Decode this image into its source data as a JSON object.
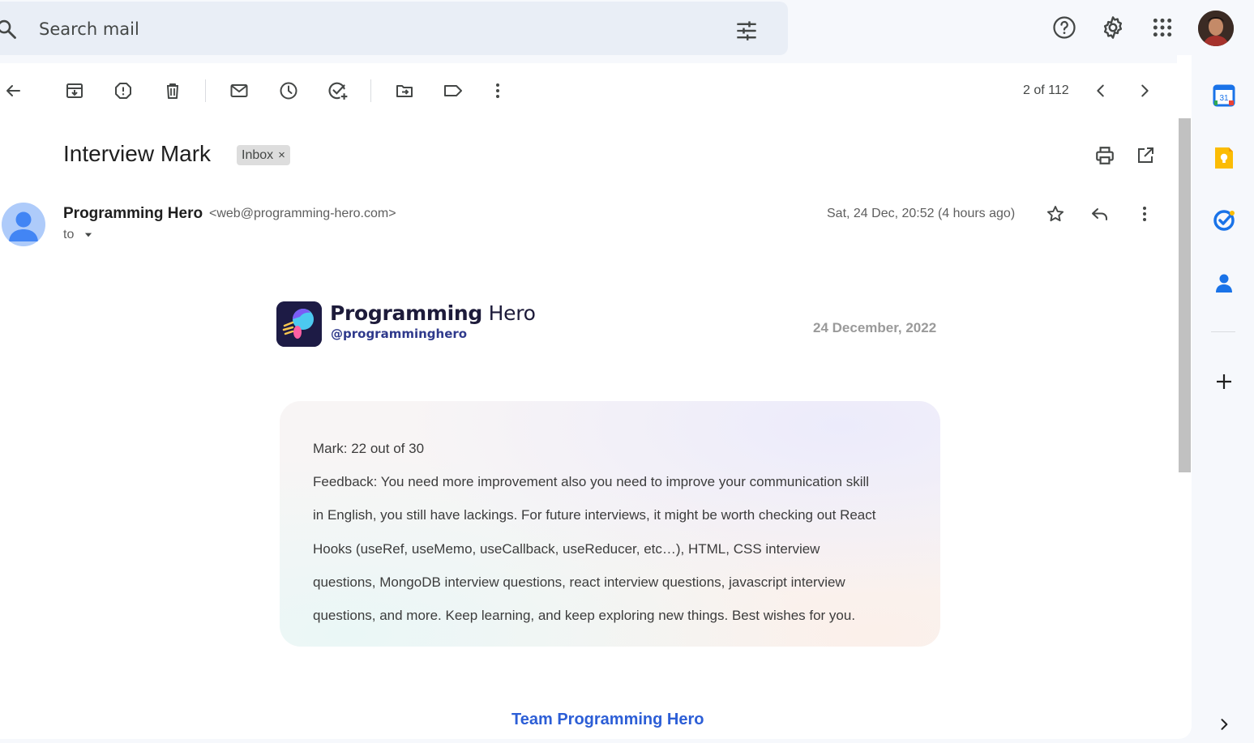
{
  "search": {
    "placeholder": "Search mail"
  },
  "header_icons": [
    "help-icon",
    "settings-icon",
    "apps-grid-icon",
    "user-avatar"
  ],
  "toolbar": {
    "actions": [
      "back",
      "archive",
      "report-spam",
      "delete",
      "mark-unread",
      "snooze",
      "add-to-tasks",
      "move-to",
      "labels",
      "more"
    ],
    "pager": "2 of 112"
  },
  "message": {
    "subject": "Interview Mark",
    "label_chip": "Inbox",
    "chip_close": "×",
    "sender_name": "Programming Hero",
    "sender_email": "<web@programming-hero.com>",
    "to": "to",
    "date": "Sat, 24 Dec, 20:52 (4 hours ago)"
  },
  "email_body": {
    "brand_bold": "Programming",
    "brand_light": " Hero",
    "handle": "@programminghero",
    "date": "24 December, 2022",
    "lines": [
      "Mark: 22 out of 30",
      "Feedback: You need more improvement also you need to improve your communication skill",
      "in English, you still have lackings. For future interviews, it might be worth checking out React",
      "Hooks (useRef, useMemo, useCallback, useReducer, etc…), HTML, CSS interview",
      "questions, MongoDB interview questions, react interview questions, javascript interview",
      "questions, and more. Keep learning, and keep exploring new things. Best wishes for you."
    ],
    "signature": "Team Programming Hero"
  },
  "side_panel": {
    "calendar_day": "31",
    "apps": [
      "calendar-icon",
      "keep-icon",
      "tasks-icon",
      "contacts-icon",
      "add-icon",
      "expand-icon"
    ]
  },
  "colors": {
    "accent": "#2c5ed6",
    "background": "#f6f8fc",
    "search_bg": "#e9eef6"
  }
}
